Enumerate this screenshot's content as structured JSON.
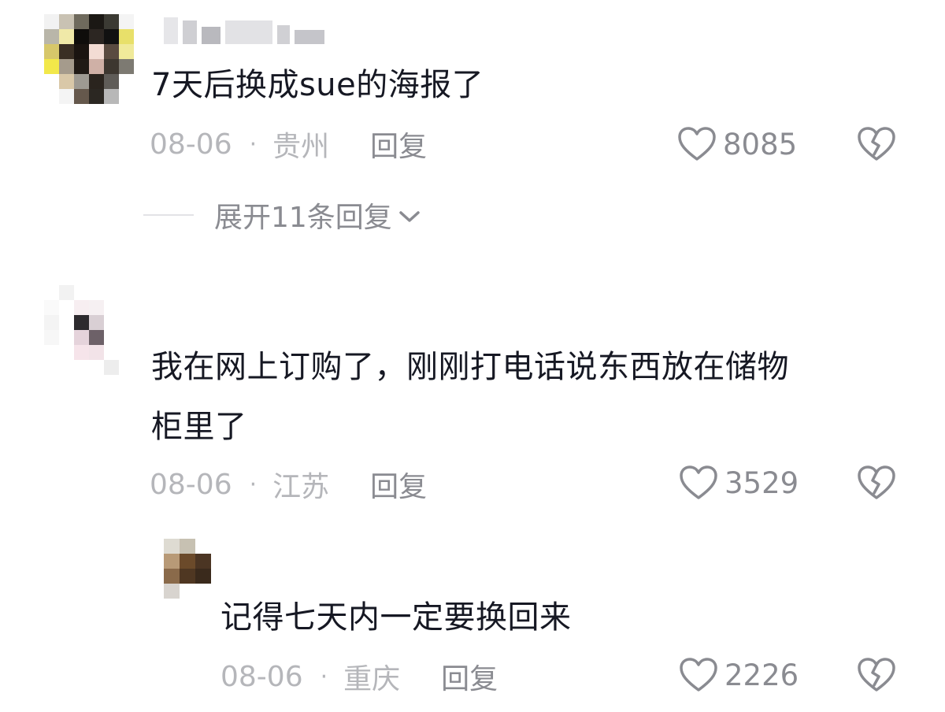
{
  "comments": [
    {
      "text": "7天后换成sue的海报了",
      "date": "08-06",
      "separator": "·",
      "location": "贵州",
      "reply_label": "回复",
      "likes": "8085",
      "expand_label": "展开11条回复"
    },
    {
      "text_line1": "我在网上订购了，刚刚打电话说东西放在储物",
      "text_line2": "柜里了",
      "date": "08-06",
      "separator": "·",
      "location": "江苏",
      "reply_label": "回复",
      "likes": "3529",
      "replies": [
        {
          "text": "记得七天内一定要换回来",
          "date": "08-06",
          "separator": "·",
          "location": "重庆",
          "reply_label": "回复",
          "likes": "2226"
        }
      ]
    }
  ],
  "icons": {
    "like": "heart-outline-icon",
    "dislike": "broken-heart-icon",
    "expand": "chevron-down-icon"
  },
  "colors": {
    "text_primary": "#161823",
    "text_meta": "#b5b6ba",
    "text_secondary": "#8a8b91"
  }
}
